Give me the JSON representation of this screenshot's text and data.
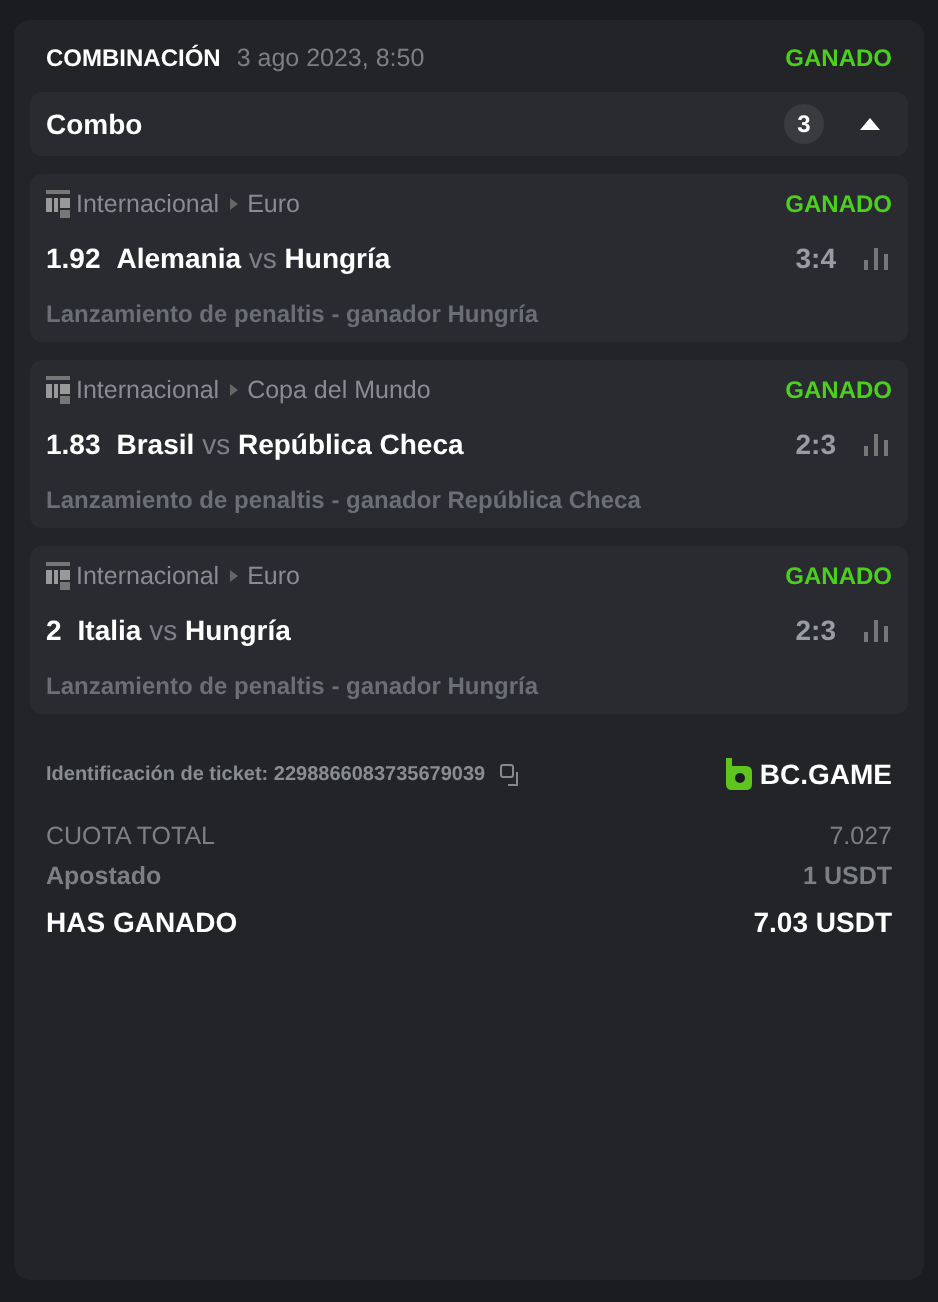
{
  "header": {
    "title": "COMBINACIÓN",
    "date": "3 ago 2023, 8:50",
    "status": "GANADO"
  },
  "combo": {
    "label": "Combo",
    "count": "3",
    "expanded": true
  },
  "legs": [
    {
      "category": "Internacional",
      "league": "Euro",
      "status": "GANADO",
      "odds": "1.92",
      "home": "Alemania",
      "vs": "vs",
      "away": "Hungría",
      "score": "3:4",
      "market": "Lanzamiento de penaltis - ganador Hungría"
    },
    {
      "category": "Internacional",
      "league": "Copa del Mundo",
      "status": "GANADO",
      "odds": "1.83",
      "home": "Brasil",
      "vs": "vs",
      "away": "República Checa",
      "score": "2:3",
      "market": "Lanzamiento de penaltis - ganador República Checa"
    },
    {
      "category": "Internacional",
      "league": "Euro",
      "status": "GANADO",
      "odds": "2",
      "home": "Italia",
      "vs": "vs",
      "away": "Hungría",
      "score": "2:3",
      "market": "Lanzamiento de penaltis - ganador Hungría"
    }
  ],
  "ticket": {
    "label": "Identificación de ticket: 2298866083735679039",
    "brand": "BC.GAME"
  },
  "summary": [
    {
      "kind": "plain",
      "label": "CUOTA TOTAL",
      "value": "7.027"
    },
    {
      "kind": "muted",
      "label": "Apostado",
      "value": "1 USDT"
    },
    {
      "kind": "total",
      "label": "HAS GANADO",
      "value": "7.03 USDT"
    }
  ]
}
